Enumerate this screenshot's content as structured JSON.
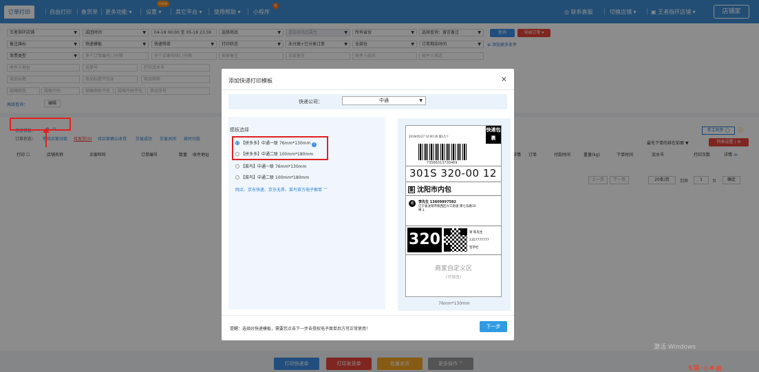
{
  "nav": {
    "items": [
      "订单打印",
      "自由打印",
      "备货单",
      "更多功能 ▾",
      "设置 ▾",
      "其它平台 ▾",
      "使用帮助 ▾",
      "小程序"
    ],
    "new_badge": "new",
    "hot_badge": "热",
    "service": "联系客服",
    "switch_shop": "切换店铺 ▾",
    "user": "王者指环店铺 ▾",
    "shop_home": "店铺家"
  },
  "filters": {
    "row1": [
      "王者指环店铺",
      "成团时间",
      "04-18 00:00 至 05-18 23:59",
      "选择商品",
      "请选择商品属性",
      "所有省份",
      "选择查询：留言备注"
    ],
    "query": "查询",
    "export": "导出订单 ▾",
    "row2": [
      "备注旗标",
      "快递模板",
      "快递筛单",
      "打印状态",
      "未分类+已分类订单",
      "全部仓",
      "订单剩余时间"
    ],
    "add_more": "添加更多条件",
    "row3": [
      "发票类型",
      "多个订单编号(,)分隔",
      "多个买家旺旺(,)分隔",
      "卖家备注",
      "买家留言",
      "收件人姓名",
      "收件人电话"
    ],
    "row4": [
      "收件人地址",
      "运单号",
      "打印流水号"
    ],
    "row5": [
      "商品标题",
      "商品标题不包含",
      "商品简称"
    ],
    "row6": [
      "规格颜色",
      "规格尺码",
      "规格颜色不包",
      "规格尺码不包",
      "单品货号"
    ],
    "advanced": "高级查询：",
    "edit": "编辑"
  },
  "main": {
    "tpl_label": "快递模板：",
    "status_label": "订单状态：",
    "statuses": [
      "等待买家付款",
      "待发货(0)",
      "待买家确认收货",
      "交易成功",
      "交易关闭",
      "按时付款"
    ],
    "headers": [
      "打印",
      "店铺名称",
      "买家旺旺",
      "订单编号",
      "数量",
      "收件地址"
    ],
    "headers_right": [
      "详情",
      "订单",
      "付款时间",
      "重量(kg)",
      "下单时间",
      "流水号",
      "打印次数",
      "详情"
    ],
    "manual_sync": "手工同步",
    "sort": "最先下单的排在前面",
    "list_setting": "列表设置",
    "prev": "上一页",
    "next": "下一页",
    "per_page": "20条/页",
    "goto": "到第",
    "page": "1",
    "page_unit": "页",
    "confirm": "确定"
  },
  "dialog": {
    "title": "添加快递打印模板",
    "express_label": "快递公司：",
    "express_value": "中通",
    "template_heading": "模板选择",
    "options": [
      "【拼多多】中通一联 76mm*130mm",
      "【拼多多】中通二联 100mm*180mm",
      "【菜鸟】中通一联 76mm*130mm",
      "【菜鸟】中通二联 100mm*180mm"
    ],
    "more": "网点、京东快递、京东无界、菜鸟官方电子面单 ﹀",
    "tip": "提醒：选择好快递模板，需要您点击下一步去授权电子面单后方可正常使用！",
    "next": "下一步"
  },
  "label": {
    "date": "2019/05/27  10:00:26  第1/1个",
    "kd": "快递包裹",
    "barnum": "73566313730469",
    "code": "301S 320-00 12",
    "city_mark": "集",
    "city": "沈阳市内包",
    "recv_mark": "收",
    "recv_name": "李先生  13609897582",
    "recv_addr": "辽宁省沈阳市铁西区兴工街道 南七东路10甲-1",
    "big": "320",
    "sender1": "寄 陈先生",
    "sender2": "1357777777",
    "sender3": "签字栏",
    "merchant": "商家自定义区",
    "merchant_sub": "(可修改)",
    "size": "76mm*130mm"
  },
  "bottom": {
    "print_express": "打印快递单",
    "print_delivery": "打印发货单",
    "batch_ship": "批量发货",
    "more": "更多操作 ^"
  },
  "watermark": "激活 Windows",
  "brand": "S英·◎♣▦"
}
